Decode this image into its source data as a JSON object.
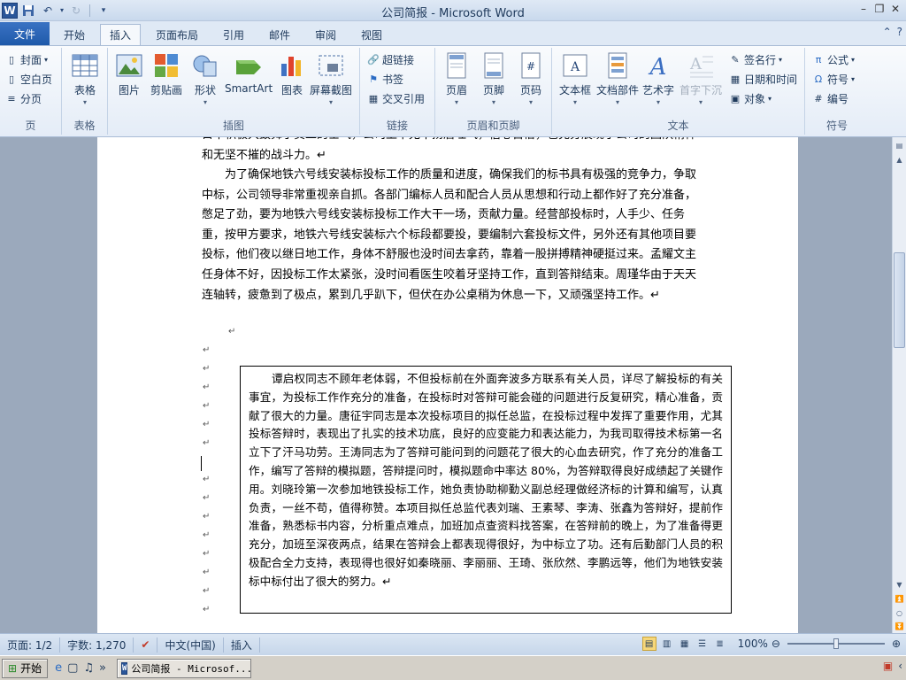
{
  "window": {
    "title": "公司简报 - Microsoft Word"
  },
  "qat": {
    "logo": "W"
  },
  "tabs": [
    "文件",
    "开始",
    "插入",
    "页面布局",
    "引用",
    "邮件",
    "审阅",
    "视图"
  ],
  "ribbon": {
    "pages": {
      "cover": "封面",
      "blank": "空白页",
      "break": "分页",
      "label": "页"
    },
    "tables": {
      "table": "表格",
      "label": "表格"
    },
    "illustrations": {
      "picture": "图片",
      "clipart": "剪贴画",
      "shapes": "形状",
      "smartart": "SmartArt",
      "chart": "图表",
      "screenshot": "屏幕截图",
      "label": "插图"
    },
    "links": {
      "hyperlink": "超链接",
      "bookmark": "书签",
      "crossref": "交叉引用",
      "label": "链接"
    },
    "headerfooter": {
      "header": "页眉",
      "footer": "页脚",
      "pagenum": "页码",
      "label": "页眉和页脚"
    },
    "text": {
      "textbox": "文本框",
      "quickparts": "文档部件",
      "wordart": "艺术字",
      "dropcap": "首字下沉",
      "signature": "签名行",
      "datetime": "日期和时间",
      "object": "对象",
      "label": "文本"
    },
    "symbols": {
      "equation": "公式",
      "symbol": "符号",
      "number": "编号",
      "label": "符号"
    }
  },
  "document": {
    "para1": "目中积极大鼓舞了员工的士气，公司上下无不扬眉吐气，信心百倍，也充分展现了公司的团队精神和无坚不摧的战斗力。↵",
    "para2": "为了确保地铁六号线安装标投标工作的质量和进度，确保我们的标书具有极强的竞争力，争取中标，公司领导非常重视亲自抓。各部门编标人员和配合人员从思想和行动上都作好了充分准备，憋足了劲，要为地铁六号线安装标投标工作大干一场，贡献力量。经营部投标时，人手少、任务重，按甲方要求，地铁六号线安装标六个标段都要投，要编制六套投标文件，另外还有其他项目要投标，他们夜以继日地工作，身体不舒服也没时间去拿药，靠着一股拼搏精神硬挺过来。孟耀文主任身体不好，因投标工作太紧张，没时间看医生咬着牙坚持工作，直到答辩结束。周瑾华由于天天连轴转，疲惫到了极点，累到几乎趴下，但伏在办公桌稍为休息一下，又顽强坚持工作。↵",
    "textbox": "谭启权同志不顾年老体弱，不但投标前在外面奔波多方联系有关人员，详尽了解投标的有关事宜，为投标工作作充分的准备，在投标时对答辩可能会碰的问题进行反复研究，精心准备，贡献了很大的力量。唐征宇同志是本次投标项目的拟任总监，在投标过程中发挥了重要作用，尤其投标答辩时，表现出了扎实的技术功底，良好的应变能力和表达能力，为我司取得技术标第一名立下了汗马功劳。王涛同志为了答辩可能问到的问题花了很大的心血去研究，作了充分的准备工作，编写了答辩的模拟题，答辩提问时，模拟题命中率达 80%，为答辩取得良好成绩起了关键作用。刘晓玲第一次参加地铁投标工作，她负责协助柳勤义副总经理做经济标的计算和编写，认真负责，一丝不苟，值得称赞。本项目拟任总监代表刘瑞、王素琴、李涛、张鑫为答辩好，提前作准备，熟悉标书内容，分析重点难点，加班加点查资料找答案，在答辩前的晚上，为了准备得更充分，加班至深夜两点，结果在答辩会上都表现得很好，为中标立了功。还有后勤部门人员的积极配合全力支持，表现得也很好如秦晓丽、李丽丽、王琦、张欣然、李鹏远等，他们为地铁安装标中标付出了很大的努力。↵",
    "para_mark": "↵"
  },
  "status": {
    "page": "页面: 1/2",
    "words": "字数: 1,270",
    "lang": "中文(中国)",
    "mode": "插入",
    "zoom": "100%",
    "zoom_level": 0.5
  },
  "taskbar": {
    "start": "开始",
    "task": "公司简报 - Microsof..."
  }
}
